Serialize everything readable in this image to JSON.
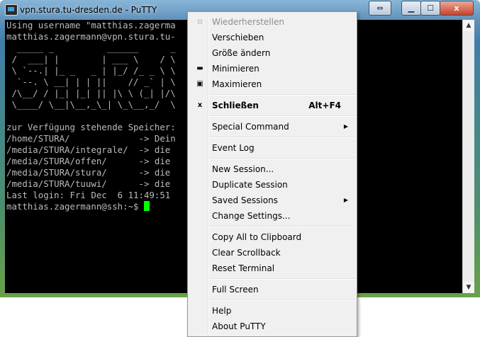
{
  "window": {
    "title": "vpn.stura.tu-dresden.de - PuTTY",
    "swap_icon": "swap-arrows-icon",
    "minimize_icon": "minimize-icon",
    "maximize_icon": "maximize-icon",
    "close_glyph": "x"
  },
  "terminal": {
    "lines": [
      "Using username \"matthias.zagerma",
      "matthias.zagermann@vpn.stura.tu-",
      "  _____ _          ______      _",
      " /  ___| |        | ___ \\    / \\",
      " \\ `--.| |_ _   _ | |_/ /_ _ \\ \\",
      "  `--. \\ __| | | ||    // _` | \\",
      " /\\__/ / |_| |_| || |\\ \\ (_| |/\\",
      " \\____/ \\__|\\__,_\\_| \\_\\__,_/  \\",
      "",
      "zur Verfügung stehende Speicher:",
      "/home/STURA/             -> Dein",
      "/media/STURA/integrale/  -> die",
      "/media/STURA/offen/      -> die",
      "/media/STURA/stura/      -> die",
      "/media/STURA/tuuwi/      -> die",
      "Last login: Fri Dec  6 11:49:51",
      "matthias.zagermann@ssh:~$ "
    ],
    "cursor_color": "#00ff00"
  },
  "menu": {
    "items": [
      {
        "label": "Wiederherstellen",
        "icon": "restore-icon",
        "state": "disabled"
      },
      {
        "label": "Verschieben"
      },
      {
        "label": "Größe ändern"
      },
      {
        "label": "Minimieren",
        "icon": "minimize-icon"
      },
      {
        "label": "Maximieren",
        "icon": "maximize-icon"
      },
      {
        "label": "Schließen",
        "icon": "close-icon",
        "shortcut": "Alt+F4",
        "style": "bold"
      },
      {
        "label": "Special Command",
        "submenu": true
      },
      {
        "label": "Event Log"
      },
      {
        "label": "New Session..."
      },
      {
        "label": "Duplicate Session"
      },
      {
        "label": "Saved Sessions",
        "submenu": true
      },
      {
        "label": "Change Settings..."
      },
      {
        "label": "Copy All to Clipboard"
      },
      {
        "label": "Clear Scrollback"
      },
      {
        "label": "Reset Terminal"
      },
      {
        "label": "Full Screen"
      },
      {
        "label": "Help"
      },
      {
        "label": "About PuTTY"
      }
    ]
  },
  "colors": {
    "terminal_bg": "#000000",
    "terminal_fg": "#bbbbbb",
    "menu_bg": "#f0f0f0"
  }
}
